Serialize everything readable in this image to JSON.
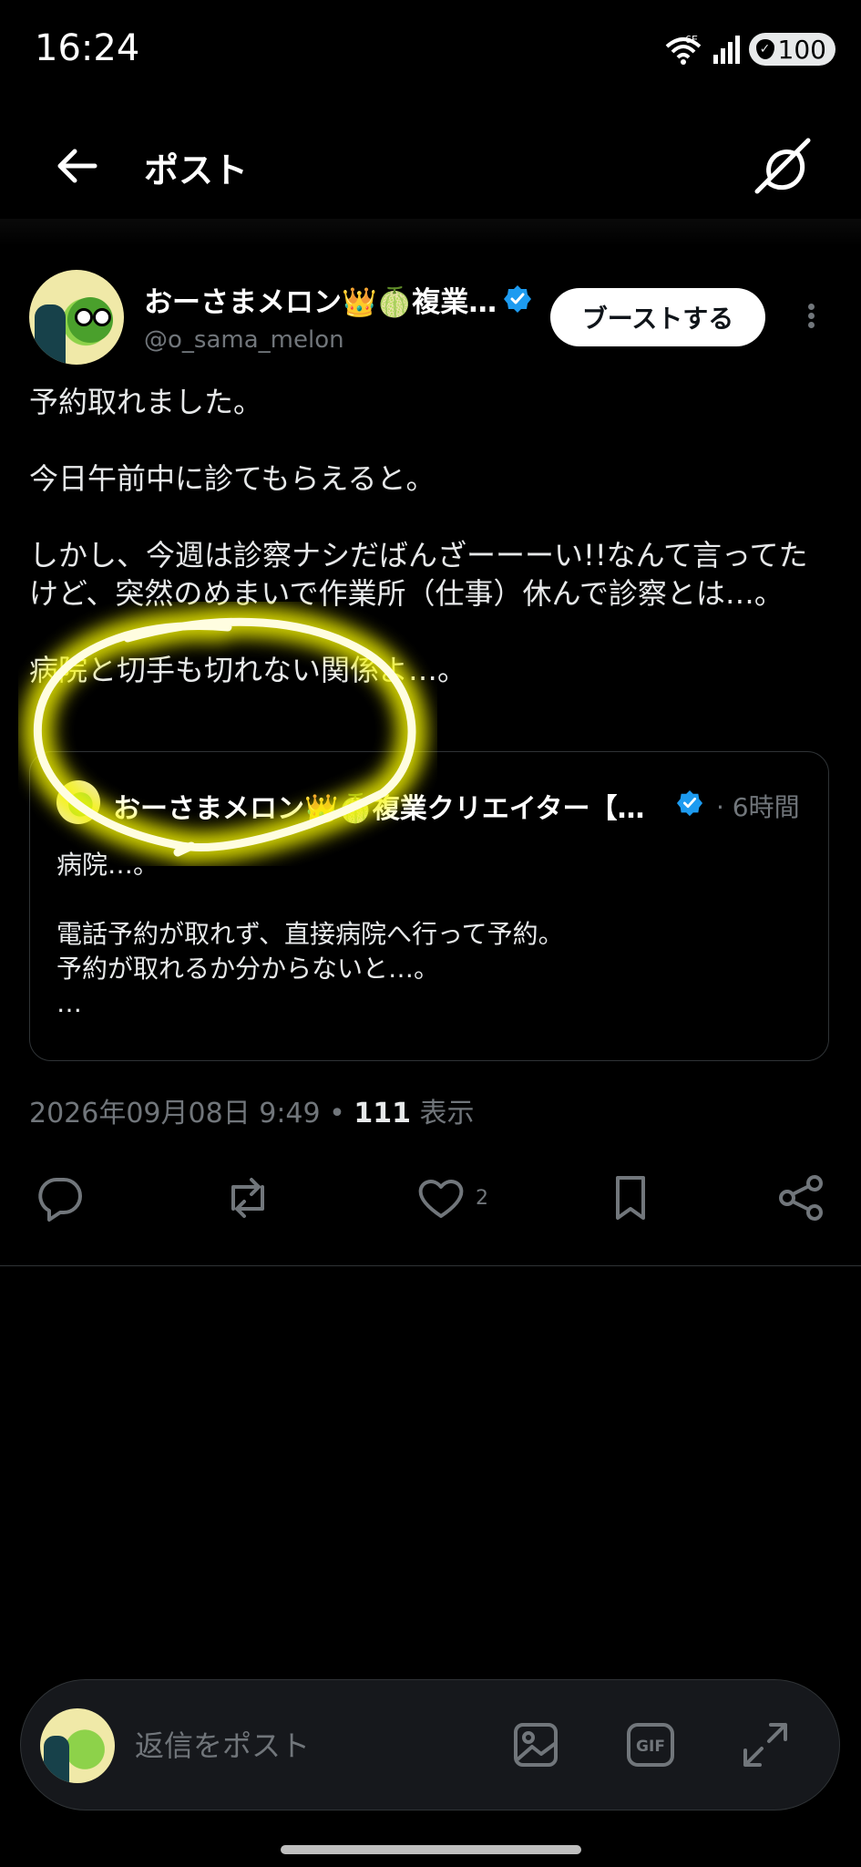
{
  "status_bar": {
    "time": "16:24",
    "network": "6E",
    "battery": "100"
  },
  "header": {
    "title": "ポスト"
  },
  "author": {
    "name": "おーさまメロン👑🍈複業…",
    "handle": "@o_sama_melon",
    "boost_label": "ブーストする"
  },
  "post": {
    "paragraphs": [
      "予約取れました。",
      "今日午前中に診てもらえると。",
      "しかし、今週は診察ナシだばんざーーーい!!なんて言ってたけど、突然のめまいで作業所（仕事）休んで診察とは…。",
      "病院と切手も切れない関係よ…。"
    ]
  },
  "quote": {
    "name": "おーさまメロン👑🍈複業クリエイター【…",
    "time": "· 6時間",
    "body": "病院…。\n\n電話予約が取れず、直接病院へ行って予約。\n予約が取れるか分からないと…。\n…"
  },
  "meta": {
    "datetime": "2026年09月08日 9:49",
    "separator": " • ",
    "views": "111",
    "views_label": " 表示"
  },
  "actions": {
    "like_count": "2"
  },
  "reply": {
    "placeholder": "返信をポスト"
  },
  "colors": {
    "background": "#000000",
    "text": "#e7e9ea",
    "muted": "#71767b",
    "verified": "#1d9bf0",
    "highlight": "#f5f500"
  },
  "icons": [
    "back-arrow-icon",
    "grok-icon",
    "verified-icon",
    "more-icon",
    "reply-icon",
    "repost-icon",
    "like-icon",
    "bookmark-icon",
    "share-icon",
    "image-icon",
    "gif-icon",
    "expand-icon"
  ]
}
